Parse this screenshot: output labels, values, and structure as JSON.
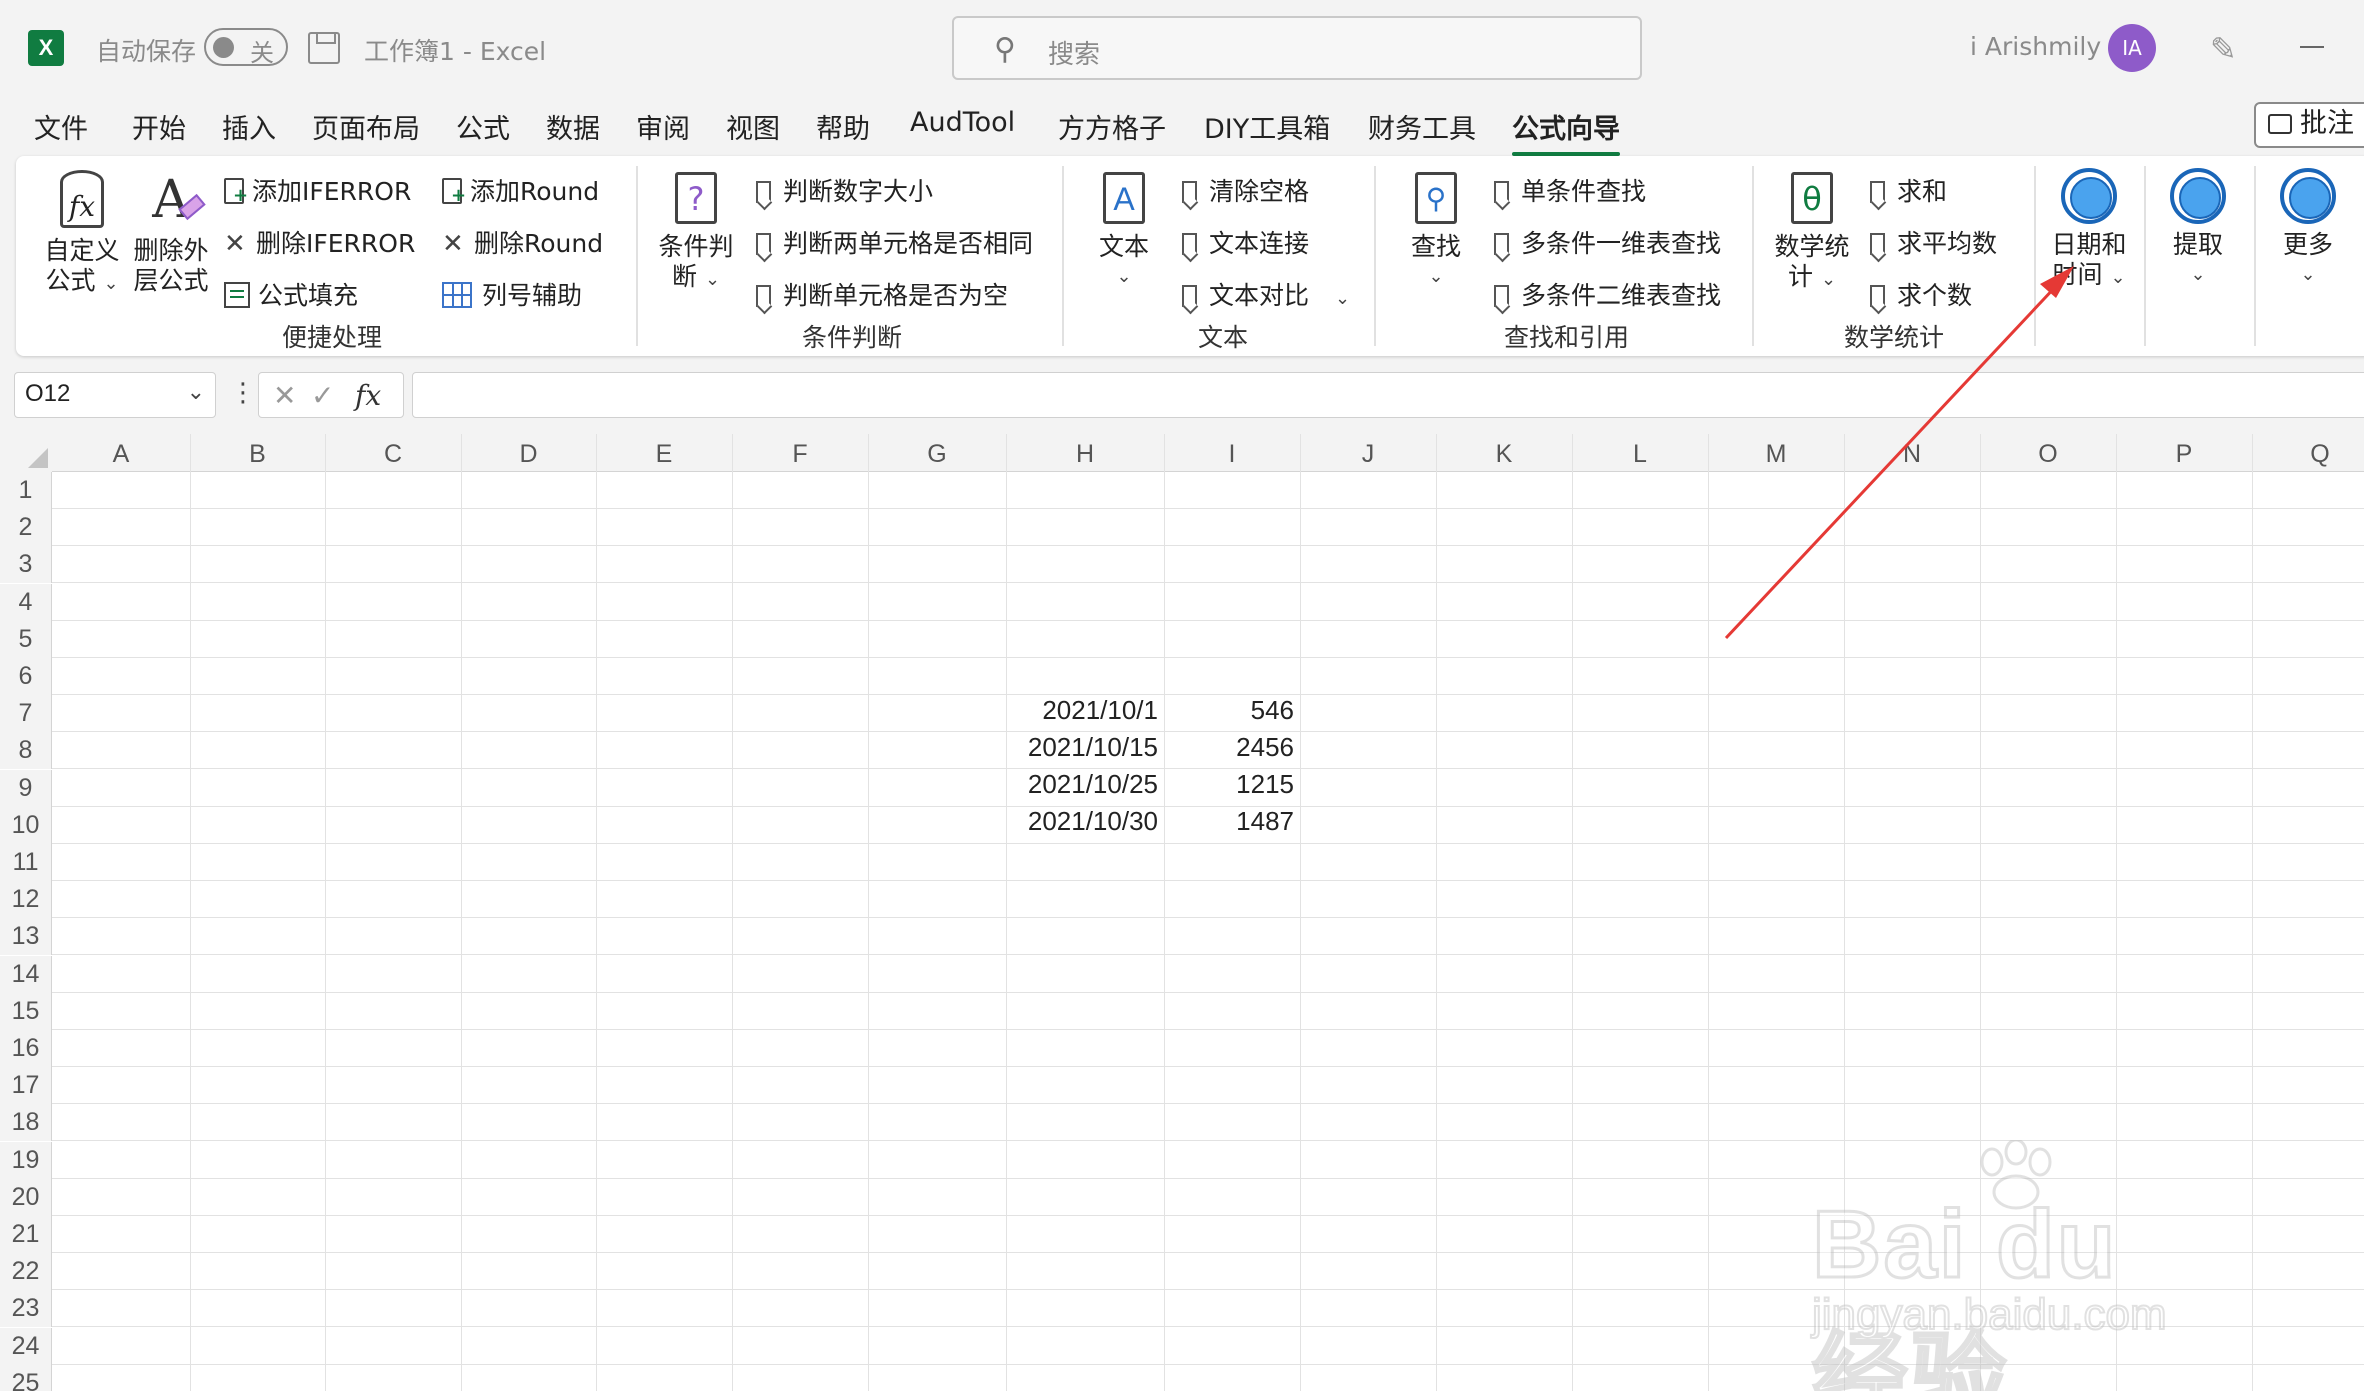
{
  "titlebar": {
    "autosave_label": "自动保存",
    "autosave_state": "关",
    "doc_title": "工作簿1  -  Excel",
    "search_placeholder": "搜索",
    "user_name": "i Arishmily",
    "avatar_initials": "IA",
    "excel_logo": "X"
  },
  "menu": {
    "tabs": [
      "文件",
      "开始",
      "插入",
      "页面布局",
      "公式",
      "数据",
      "审阅",
      "视图",
      "帮助",
      "AudTool",
      "方方格子",
      "DIY工具箱",
      "财务工具",
      "公式向导"
    ],
    "active_tab": "公式向导",
    "comment_button": "批注"
  },
  "ribbon": {
    "quick": {
      "custom_formula": [
        "自定义",
        "公式"
      ],
      "remove_outer": [
        "删除外",
        "层公式"
      ],
      "add_iferror": "添加IFERROR",
      "remove_iferror": "删除IFERROR",
      "formula_fill": "公式填充",
      "add_round": "添加Round",
      "remove_round": "删除Round",
      "col_helper": "列号辅助",
      "group_label": "便捷处理"
    },
    "condition": {
      "big": [
        "条件判",
        "断"
      ],
      "item1": "判断数字大小",
      "item2": "判断两单元格是否相同",
      "item3": "判断单元格是否为空",
      "group_label": "条件判断"
    },
    "text": {
      "big": "文本",
      "item1": "清除空格",
      "item2": "文本连接",
      "item3": "文本对比",
      "group_label": "文本"
    },
    "lookup": {
      "big": "查找",
      "item1": "单条件查找",
      "item2": "多条件一维表查找",
      "item3": "多条件二维表查找",
      "group_label": "查找和引用"
    },
    "math": {
      "big": [
        "数学统",
        "计"
      ],
      "item1": "求和",
      "item2": "求平均数",
      "item3": "求个数",
      "group_label": "数学统计"
    },
    "datetime": [
      "日期和",
      "时间"
    ],
    "extract": "提取",
    "more": "更多"
  },
  "formula_bar": {
    "name_box": "O12",
    "fx": "fx",
    "formula": ""
  },
  "sheet": {
    "columns": [
      "A",
      "B",
      "C",
      "D",
      "E",
      "F",
      "G",
      "H",
      "I",
      "J",
      "K",
      "L",
      "M",
      "N",
      "O",
      "P",
      "Q"
    ],
    "rows": [
      "1",
      "2",
      "3",
      "4",
      "5",
      "6",
      "7",
      "8",
      "9",
      "10",
      "11",
      "12",
      "13",
      "14",
      "15",
      "16",
      "17",
      "18",
      "19",
      "20",
      "21",
      "22",
      "23",
      "24",
      "25"
    ],
    "data": [
      {
        "date": "2021/10/1",
        "value": "546"
      },
      {
        "date": "2021/10/15",
        "value": "2456"
      },
      {
        "date": "2021/10/25",
        "value": "1215"
      },
      {
        "date": "2021/10/30",
        "value": "1487"
      }
    ]
  },
  "watermark": {
    "brand": "Bai du 经验",
    "url": "jingyan.baidu.com"
  },
  "colors": {
    "excel_green": "#107c41",
    "avatar": "#8e5bc9",
    "annotation_arrow": "#e53935",
    "circle_icon": "#4aa3ee"
  }
}
